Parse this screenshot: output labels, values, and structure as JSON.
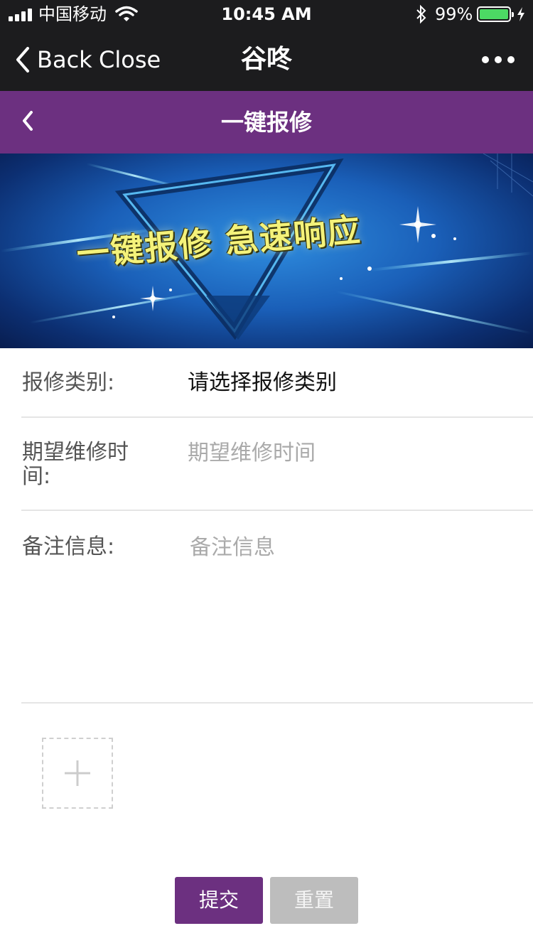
{
  "status_bar": {
    "carrier": "中国移动",
    "time": "10:45 AM",
    "battery": "99%",
    "battery_level": 0.99
  },
  "wechat_nav": {
    "back_label": "Back",
    "close_label": "Close",
    "title": "谷咚"
  },
  "page_header": {
    "title": "一键报修"
  },
  "banner": {
    "slogan": "一键报修 急速响应"
  },
  "form": {
    "category_label": "报修类别:",
    "category_value": "请选择报修类别",
    "time_label_line1": "期望维修时",
    "time_label_line2": "间:",
    "time_placeholder": "期望维修时间",
    "note_label": "备注信息:",
    "note_placeholder": "备注信息"
  },
  "actions": {
    "submit_label": "提交",
    "reset_label": "重置"
  },
  "colors": {
    "accent": "#6c3080",
    "nav_bg": "#1c1c1e",
    "battery_green": "#4cd964",
    "reset_gray": "#bdbdbd"
  }
}
